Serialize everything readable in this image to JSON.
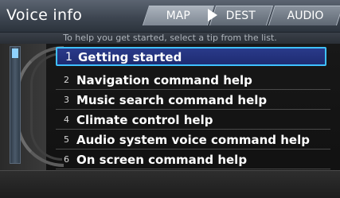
{
  "header": {
    "title": "Voice info",
    "subtitle": "To help you get started, select a tip from the list.",
    "tabs": [
      {
        "label": "MAP"
      },
      {
        "label": "DEST"
      },
      {
        "label": "AUDIO"
      }
    ]
  },
  "list": {
    "selected_index": 1,
    "items": [
      {
        "num": "1",
        "label": "Getting started"
      },
      {
        "num": "2",
        "label": "Navigation command help"
      },
      {
        "num": "3",
        "label": "Music search command help"
      },
      {
        "num": "4",
        "label": "Climate control help"
      },
      {
        "num": "5",
        "label": "Audio system voice command help"
      },
      {
        "num": "6",
        "label": "On screen command help"
      }
    ]
  },
  "colors": {
    "selection_border": "#3fc1ff",
    "selection_fill": "#2a3a8a",
    "scroll_thumb": "#8fd2ff"
  },
  "icons": {
    "tab_arrow": "right-arrow-icon"
  }
}
